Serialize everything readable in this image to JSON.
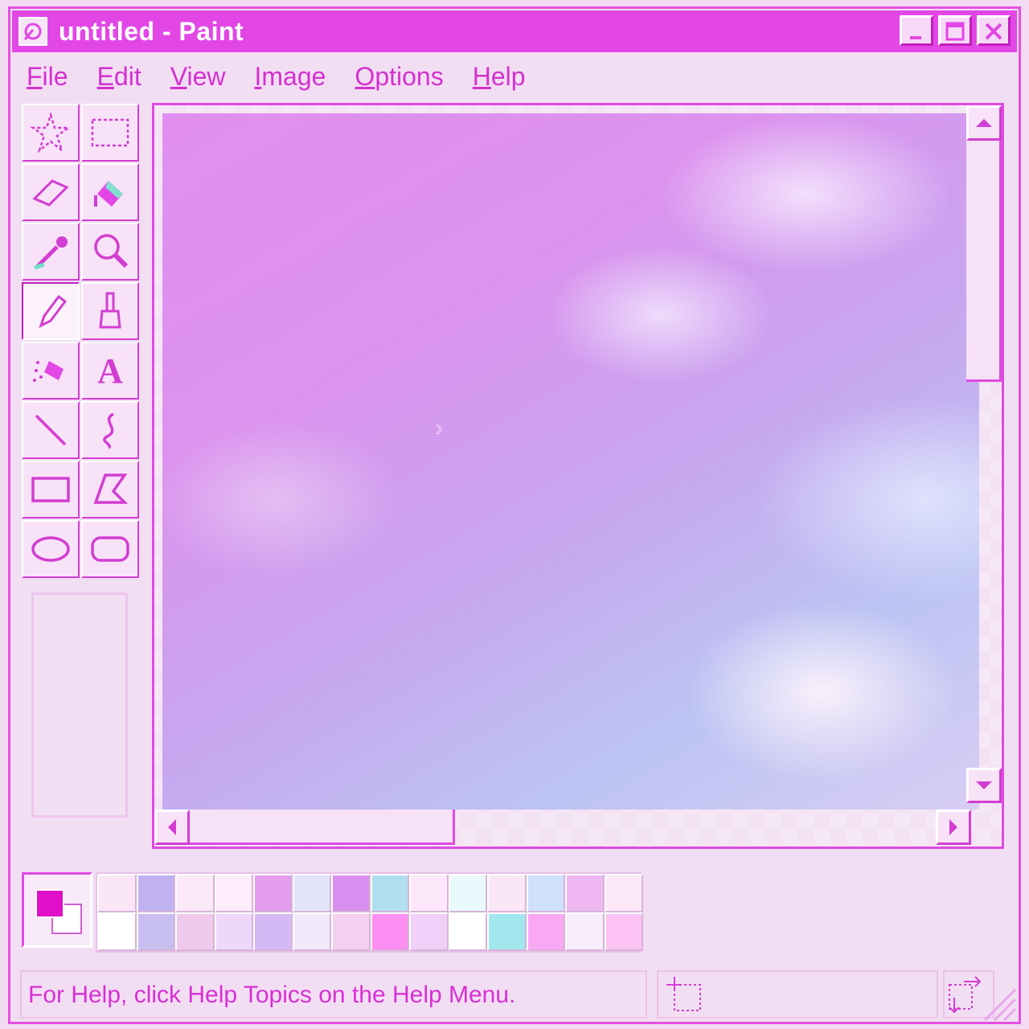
{
  "window": {
    "title": "untitled - Paint",
    "controls": [
      "minimize",
      "maximize",
      "close"
    ]
  },
  "menubar": {
    "items": [
      "File",
      "Edit",
      "View",
      "Image",
      "Options",
      "Help"
    ]
  },
  "toolbox": {
    "tools": [
      {
        "name": "free-form-select",
        "icon": "star-select-icon"
      },
      {
        "name": "select",
        "icon": "rect-select-icon"
      },
      {
        "name": "eraser",
        "icon": "eraser-icon"
      },
      {
        "name": "fill-with-color",
        "icon": "paint-bucket-icon"
      },
      {
        "name": "pick-color",
        "icon": "eyedropper-icon"
      },
      {
        "name": "magnifier",
        "icon": "magnifier-icon"
      },
      {
        "name": "pencil",
        "icon": "pencil-icon",
        "selected": true
      },
      {
        "name": "brush",
        "icon": "brush-icon"
      },
      {
        "name": "airbrush",
        "icon": "airbrush-icon"
      },
      {
        "name": "text",
        "icon": "text-icon",
        "glyph": "A"
      },
      {
        "name": "line",
        "icon": "line-icon"
      },
      {
        "name": "curve",
        "icon": "curve-icon"
      },
      {
        "name": "rectangle",
        "icon": "rectangle-icon"
      },
      {
        "name": "polygon",
        "icon": "polygon-icon"
      },
      {
        "name": "ellipse",
        "icon": "ellipse-icon"
      },
      {
        "name": "rounded-rectangle",
        "icon": "rounded-rectangle-icon"
      }
    ]
  },
  "colors": {
    "accent": "#e247e6",
    "foreground": "#e010c8",
    "background": "#ffffff",
    "palette": [
      "#fbe6f8",
      "#c0b2f2",
      "#fbe8f8",
      "#fcecfc",
      "#e39ef0",
      "#e3e4fa",
      "#d98ff0",
      "#b2dfef",
      "#fce8fa",
      "#e9f8fb",
      "#fbe6f8",
      "#cfe0fb",
      "#efb8f3",
      "#fce8f8",
      "#ffffff",
      "#c8bff0",
      "#efc9ec",
      "#eed7fa",
      "#d5b9f5",
      "#f1eafa",
      "#f3d0ef",
      "#fb8ff2",
      "#f0d0f8",
      "#ffffff",
      "#a2e7ee",
      "#f9a8f3",
      "#f6ecfa",
      "#fbc2f3"
    ]
  },
  "statusbar": {
    "help_text": "For Help, click Help Topics on the Help Menu."
  }
}
